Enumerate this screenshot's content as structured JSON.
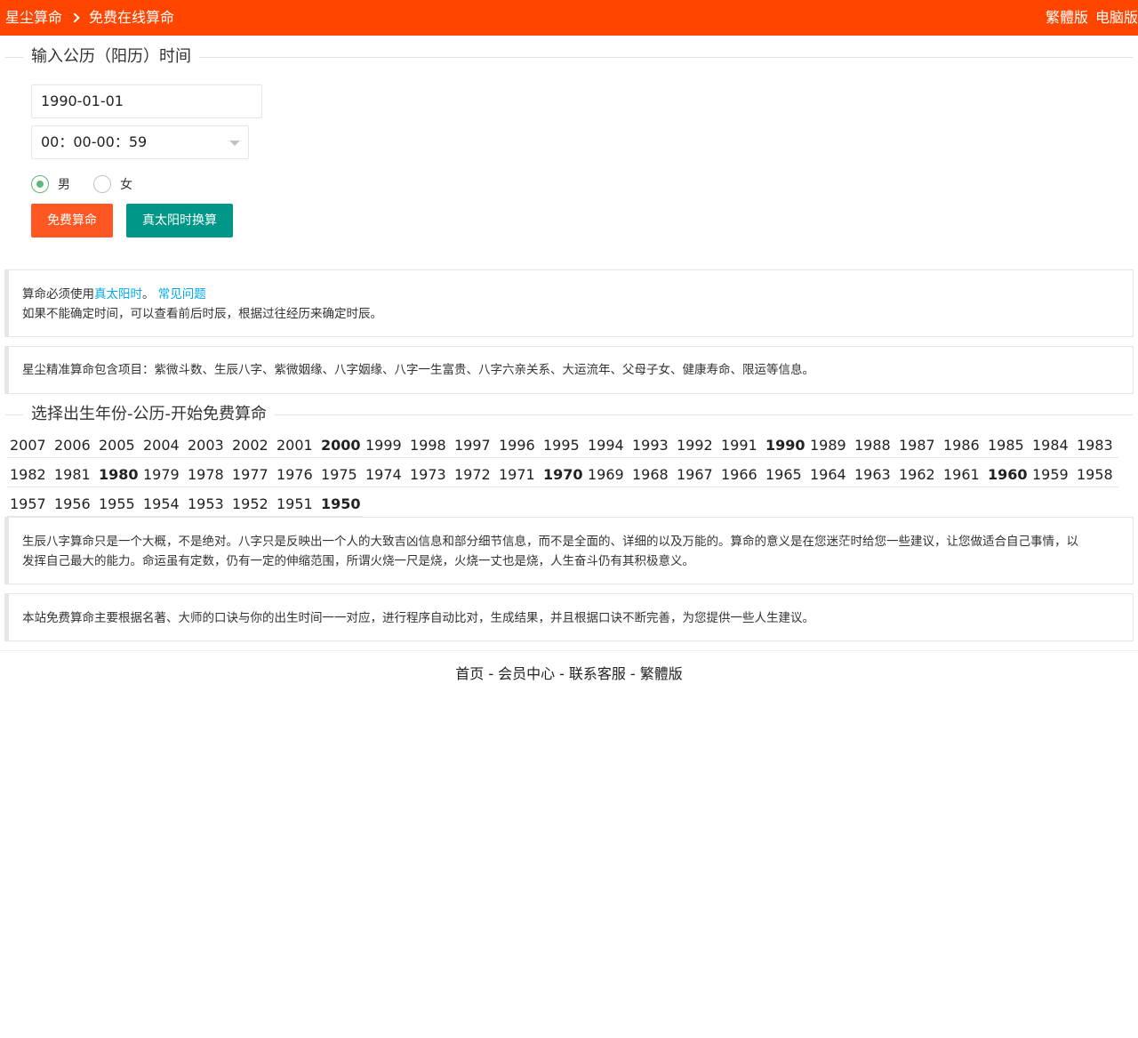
{
  "header": {
    "site_name": "星尘算命",
    "page_name": "免费在线算命",
    "links": [
      "繁體版",
      "电脑版"
    ]
  },
  "form": {
    "legend": "输入公历（阳历）时间",
    "date_value": "1990-01-01",
    "time_value": "00：00-00：59",
    "gender_options": [
      {
        "label": "男",
        "checked": true
      },
      {
        "label": "女",
        "checked": false
      }
    ],
    "submit_label": "免费算命",
    "solar_label": "真太阳时换算"
  },
  "notice": {
    "prefix": "算命必须使用",
    "link_solar": "真太阳时",
    "middle": "。 ",
    "link_faq": "常见问题",
    "line2": "如果不能确定时间，可以查看前后时辰，根据过往经历来确定时辰。"
  },
  "items_note": "星尘精准算命包含项目：紫微斗数、生辰八字、紫微姻缘、八字姻缘、八字一生富贵、八字六亲关系、大运流年、父母子女、健康寿命、限运等信息。",
  "years_section": {
    "legend": "选择出生年份-公历-开始免费算命",
    "rows": [
      [
        "2007",
        "2006",
        "2005",
        "2004",
        "2003",
        "2002",
        "2001",
        "2000",
        "1999",
        "1998",
        "1997",
        "1996",
        "1995",
        "1994",
        "1993",
        "1992",
        "1991",
        "1990",
        "1989",
        "1988",
        "1987",
        "1986",
        "1985",
        "1984",
        "1983"
      ],
      [
        "1982",
        "1981",
        "1980",
        "1979",
        "1978",
        "1977",
        "1976",
        "1975",
        "1974",
        "1973",
        "1972",
        "1971",
        "1970",
        "1969",
        "1968",
        "1967",
        "1966",
        "1965",
        "1964",
        "1963",
        "1962",
        "1961",
        "1960",
        "1959",
        "1958"
      ],
      [
        "1957",
        "1956",
        "1955",
        "1954",
        "1953",
        "1952",
        "1951",
        "1950"
      ]
    ],
    "bold_years": [
      "2000",
      "1990",
      "1980",
      "1970",
      "1960",
      "1950"
    ]
  },
  "bazi_note": {
    "line1": "生辰八字算命只是一个大概，不是绝对。八字只是反映出一个人的大致吉凶信息和部分细节信息，而不是全面的、详细的以及万能的。算命的意义是在您迷茫时给您一些建议，让您做适合自己事情，以",
    "line2": "发挥自己最大的能力。命运虽有定数，仍有一定的伸缩范围，所谓火烧一尺是烧，火烧一丈也是烧，人生奋斗仍有其积极意义。"
  },
  "site_note": "本站免费算命主要根据名著、大师的口诀与你的出生时间一一对应，进行程序自动比对，生成结果，并且根据口诀不断完善，为您提供一些人生建议。",
  "footer": {
    "links": [
      "首页",
      "会员中心",
      "联系客服",
      "繁體版"
    ],
    "separator": "-"
  }
}
